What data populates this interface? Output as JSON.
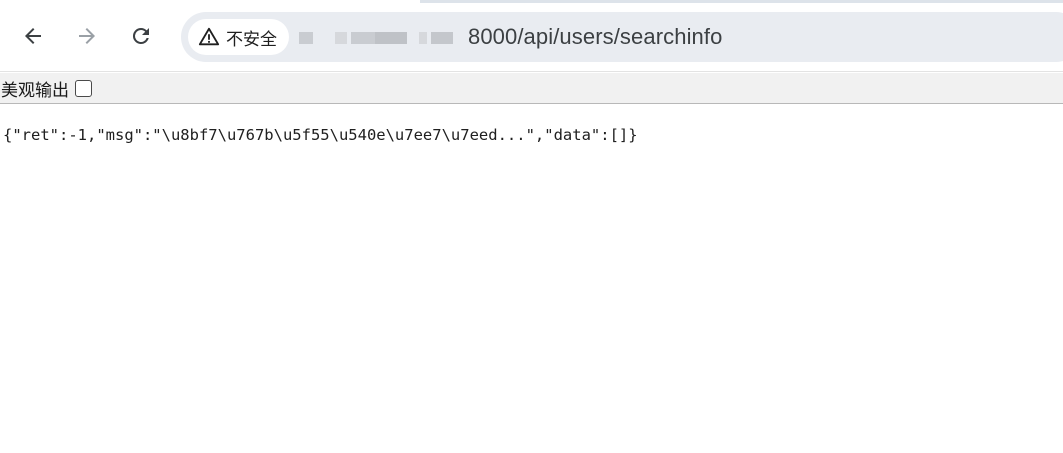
{
  "browser": {
    "nav": {
      "back_icon": "arrow-left-icon",
      "forward_icon": "arrow-right-icon",
      "reload_icon": "reload-icon"
    },
    "omnibox": {
      "security_icon": "warning-triangle-icon",
      "security_label": "不安全",
      "url_visible": "8000/api/users/searchinfo"
    },
    "colors": {
      "omnibox_bg": "#e9ecf1",
      "disabled_icon": "#9aa0a6",
      "active_icon": "#3c4043"
    }
  },
  "pretty_print": {
    "label": "美观输出",
    "checked": false
  },
  "body": {
    "json_text": "{\"ret\":-1,\"msg\":\"\\u8bf7\\u767b\\u5f55\\u540e\\u7ee7\\u7eed...\",\"data\":[]}"
  }
}
